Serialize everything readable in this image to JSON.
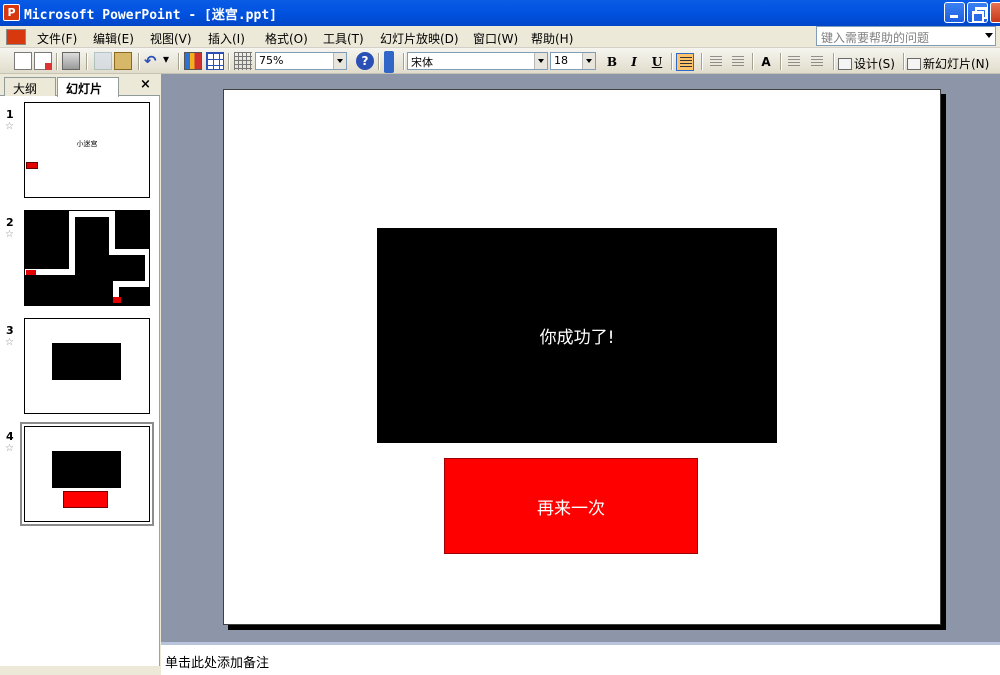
{
  "window": {
    "title": "Microsoft PowerPoint - [迷宫.ppt]"
  },
  "menubar": {
    "items": [
      "文件(F)",
      "编辑(E)",
      "视图(V)",
      "插入(I)",
      "格式(O)",
      "工具(T)",
      "幻灯片放映(D)",
      "窗口(W)",
      "帮助(H)"
    ],
    "help_placeholder": "键入需要帮助的问题"
  },
  "toolbar": {
    "zoom": "75%",
    "font_name": "宋体",
    "font_size": "18",
    "bold_label": "B",
    "italic_label": "I",
    "underline_label": "U",
    "increase_font_label": "A",
    "design_label": "设计(S)",
    "new_slide_label": "新幻灯片(N)"
  },
  "leftpane": {
    "tabs": [
      "大纲",
      "幻灯片"
    ],
    "close_label": "×",
    "slides": [
      {
        "number": "1",
        "text": "小迷宫"
      },
      {
        "number": "2"
      },
      {
        "number": "3"
      },
      {
        "number": "4"
      }
    ]
  },
  "slide": {
    "box_text": "你成功了!",
    "button_text": "再来一次"
  },
  "notes": {
    "placeholder": "单击此处添加备注"
  },
  "colors": {
    "titlebar": "#0a5ce6",
    "workspace": "#8d95a8",
    "button_red": "#ff0000",
    "box_black": "#000000"
  }
}
